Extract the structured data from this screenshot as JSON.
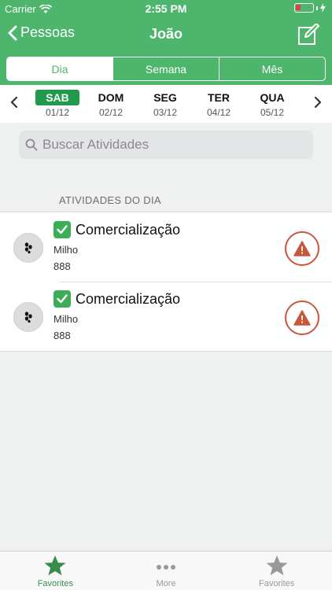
{
  "status_bar": {
    "carrier": "Carrier",
    "time": "2:55 PM"
  },
  "navbar": {
    "back_label": "Pessoas",
    "title": "João"
  },
  "segments": [
    {
      "label": "Dia",
      "active": true
    },
    {
      "label": "Semana",
      "active": false
    },
    {
      "label": "Mês",
      "active": false
    }
  ],
  "days": [
    {
      "name": "SAB",
      "date": "01/12",
      "active": true
    },
    {
      "name": "DOM",
      "date": "02/12",
      "active": false
    },
    {
      "name": "SEG",
      "date": "03/12",
      "active": false
    },
    {
      "name": "TER",
      "date": "04/12",
      "active": false
    },
    {
      "name": "QUA",
      "date": "05/12",
      "active": false
    }
  ],
  "search": {
    "placeholder": "Buscar Atividades",
    "value": ""
  },
  "section": {
    "label": "ATIVIDADES DO DIA"
  },
  "activities": [
    {
      "title": "Comercialização",
      "crop": "Milho",
      "value": "888"
    },
    {
      "title": "Comercialização",
      "crop": "Milho",
      "value": "888"
    }
  ],
  "tabbar": [
    {
      "label": "Favorites",
      "icon": "star-icon",
      "active": true
    },
    {
      "label": "More",
      "icon": "more-icon",
      "active": false
    },
    {
      "label": "Favorites",
      "icon": "star-icon",
      "active": false
    }
  ],
  "colors": {
    "primary_green": "#4db56c",
    "active_day": "#219b4b",
    "alert": "#c8573a",
    "tab_active": "#3a8c4e"
  }
}
